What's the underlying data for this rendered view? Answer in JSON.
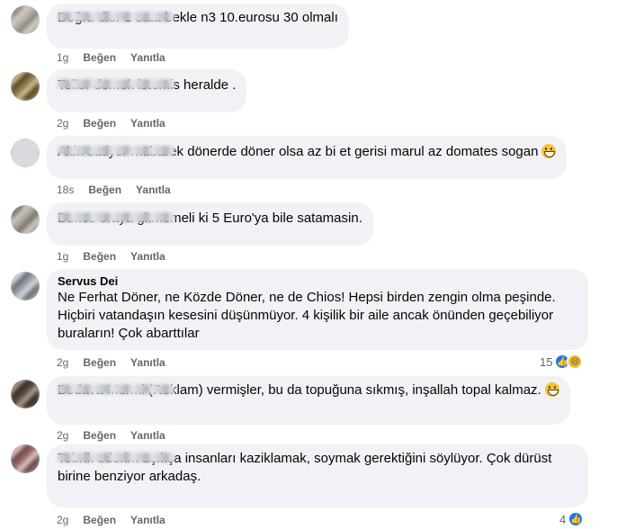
{
  "actions": {
    "like": "Beğen",
    "reply": "Yanıtla"
  },
  "comments": [
    {
      "author": "",
      "text": "Doğru dior 1 saat bekle n3 10.eurosu 30 olmalı",
      "time": "1g",
      "reactions": ""
    },
    {
      "author": "",
      "text": "Teller demek istemis heralde .",
      "time": "2g",
      "reactions": ""
    },
    {
      "author": "",
      "text": "Altin satiyor mübarek dönerde döner olsa az bi et gerisi marul az domates sogan",
      "time": "18s",
      "reactions": "",
      "emoji": "grinning-face"
    },
    {
      "author": "",
      "text": "Bence oraya gitmemeli ki 5 Euro'ya bile satamasin.",
      "time": "1g",
      "reactions": ""
    },
    {
      "author": "Servus Dei",
      "text": "Ne Ferhat Döner, ne Közde Döner, ne de Chios! Hepsi birden zengin olma peşinde.\nHiçbiri vatandaşın kesesini düşünmüyor. 4 kişilik bir aile ancak önünden geçebiliyor\nburaların! Çok abarttılar",
      "time": "2g",
      "reactions": "15",
      "reaction_icons": [
        "like",
        "haha"
      ]
    },
    {
      "author": "",
      "text": "Bedava Mermi (Reklam) vermişler, bu da topuğuna sıkmış, inşallah topal kalmaz.",
      "time": "2g",
      "reactions": "",
      "emoji": "grinning-face"
    },
    {
      "author": "",
      "text": "Tebrik ederim açıkça insanları kaziklamak, soymak gerektiğini söylüyor. Çok dürüst\nbirine benziyor arkadaş.",
      "time": "2g",
      "reactions": "4",
      "reaction_icons": [
        "like"
      ]
    }
  ]
}
